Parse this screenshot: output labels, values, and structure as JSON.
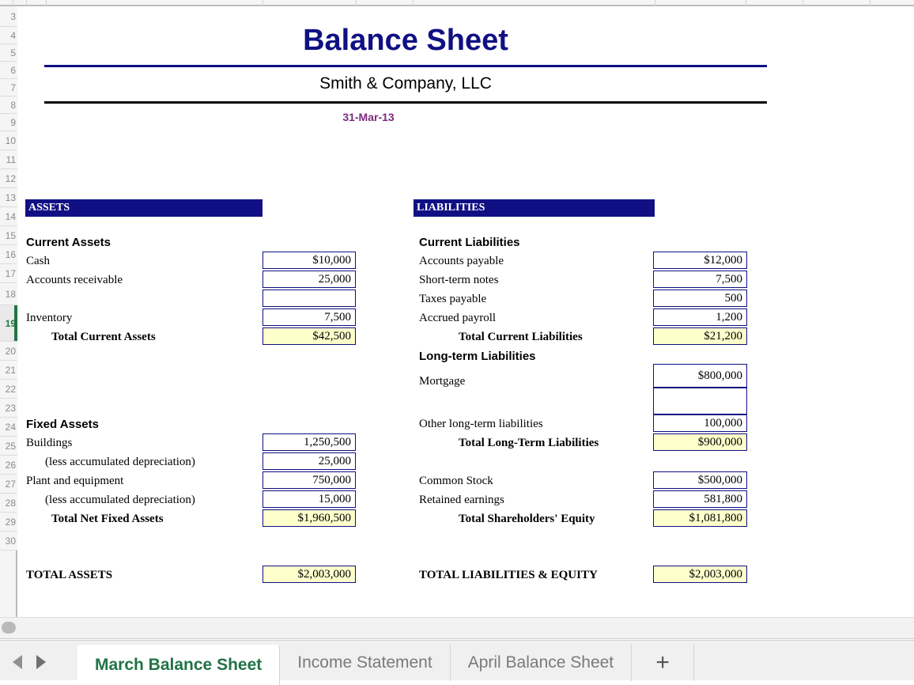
{
  "document": {
    "title": "Balance Sheet",
    "company": "Smith & Company, LLC",
    "as_of_date": "31-Mar-13",
    "colors": {
      "title_navy": "#101084",
      "section_bar": "#000080",
      "date_purple": "#7c2a7c",
      "total_shade": "#FFFFCC",
      "active_tab_green": "#217346"
    }
  },
  "assets": {
    "section_label": "ASSETS",
    "current": {
      "heading": "Current Assets",
      "rows": [
        {
          "label": "Cash",
          "value": "$10,000"
        },
        {
          "label": "Accounts receivable",
          "value": "25,000"
        },
        {
          "label": "",
          "value": ""
        },
        {
          "label": "Inventory",
          "value": "7,500"
        }
      ],
      "total_label": "Total Current Assets",
      "total_value": "$42,500"
    },
    "fixed": {
      "heading": "Fixed Assets",
      "rows": [
        {
          "label": "Buildings",
          "value": "1,250,500"
        },
        {
          "label": "(less accumulated depreciation)",
          "value": "25,000"
        },
        {
          "label": "Plant and equipment",
          "value": "750,000"
        },
        {
          "label": "(less accumulated depreciation)",
          "value": "15,000"
        }
      ],
      "total_label": "Total Net Fixed Assets",
      "total_value": "$1,960,500"
    },
    "grand_total_label": "TOTAL ASSETS",
    "grand_total_value": "$2,003,000"
  },
  "liabilities": {
    "section_label": "LIABILITIES",
    "current": {
      "heading": "Current Liabilities",
      "rows": [
        {
          "label": "Accounts payable",
          "value": "$12,000"
        },
        {
          "label": "Short-term notes",
          "value": "7,500"
        },
        {
          "label": "Taxes payable",
          "value": "500"
        },
        {
          "label": "Accrued payroll",
          "value": "1,200"
        }
      ],
      "total_label": "Total Current Liabilities",
      "total_value": "$21,200"
    },
    "longterm": {
      "heading": "Long-term Liabilities",
      "rows": [
        {
          "label": "Mortgage",
          "value": "$800,000"
        },
        {
          "label": "",
          "value": ""
        },
        {
          "label": "Other long-term liabilities",
          "value": "100,000"
        }
      ],
      "total_label": "Total Long-Term Liabilities",
      "total_value": "$900,000"
    },
    "equity": {
      "rows": [
        {
          "label": "Common Stock",
          "value": "$500,000"
        },
        {
          "label": "Retained earnings",
          "value": "581,800"
        }
      ],
      "total_label": "Total Shareholders' Equity",
      "total_value": "$1,081,800"
    },
    "grand_total_label": "TOTAL LIABILITIES & EQUITY",
    "grand_total_value": "$2,003,000"
  },
  "row_headers": [
    {
      "num": "3"
    },
    {
      "num": "4"
    },
    {
      "num": "5"
    },
    {
      "num": "6"
    },
    {
      "num": "7"
    },
    {
      "num": "8"
    },
    {
      "num": "9"
    },
    {
      "num": "10"
    },
    {
      "num": "11"
    },
    {
      "num": "12"
    },
    {
      "num": "13"
    },
    {
      "num": "14"
    },
    {
      "num": "15"
    },
    {
      "num": "16"
    },
    {
      "num": "17"
    },
    {
      "num": "18"
    },
    {
      "num": "19"
    },
    {
      "num": "20"
    },
    {
      "num": "21"
    },
    {
      "num": "22"
    },
    {
      "num": "23"
    },
    {
      "num": "24"
    },
    {
      "num": "25"
    },
    {
      "num": "26"
    },
    {
      "num": "27"
    },
    {
      "num": "28"
    },
    {
      "num": "29"
    },
    {
      "num": "30"
    }
  ],
  "selected_row": "19",
  "sheet_tabs": {
    "prev_label": "◀",
    "next_label": "▶",
    "add_label": "+",
    "tabs": [
      {
        "label": "March Balance Sheet",
        "active": true
      },
      {
        "label": "Income Statement",
        "active": false
      },
      {
        "label": "April Balance Sheet",
        "active": false
      }
    ]
  }
}
